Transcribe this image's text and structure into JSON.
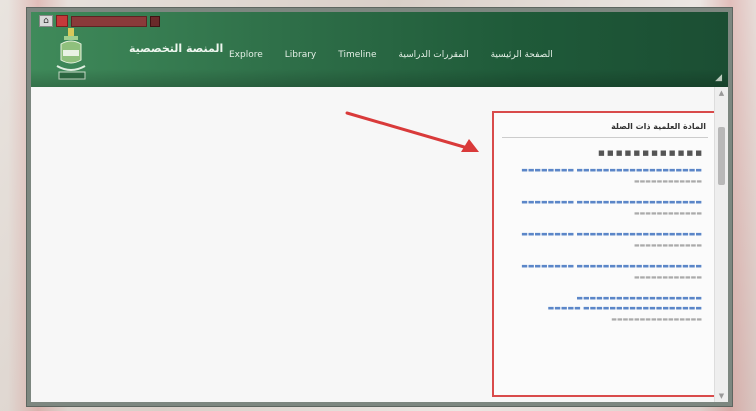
{
  "site": {
    "title": "المنصة التخصصية",
    "logo_icon": "university-emblem-icon",
    "topbar_home_icon": "home-icon"
  },
  "nav": {
    "items": [
      {
        "label": "Explore"
      },
      {
        "label": "Library"
      },
      {
        "label": "Timeline"
      },
      {
        "label": "المقررات الدراسية"
      },
      {
        "label": "الصفحة الرئيسية"
      }
    ]
  },
  "panel": {
    "title": "المادة العلمية ذات الصلة",
    "subtitle": "■ ■ ■ ■ ■ ■ ■ ■ ■ ■ ■ ■",
    "results": [
      {
        "link": "▬▬▬▬▬▬▬▬▬▬▬▬▬▬▬▬▬▬▬ ▬▬▬▬▬▬▬▬",
        "meta": "▬▬▬▬▬▬▬▬▬▬▬▬"
      },
      {
        "link": "▬▬▬▬▬▬▬▬▬▬▬▬▬▬▬▬▬▬▬ ▬▬▬▬▬▬▬▬",
        "meta": "▬▬▬▬▬▬▬▬▬▬▬▬"
      },
      {
        "link": "▬▬▬▬▬▬▬▬▬▬▬▬▬▬▬▬▬▬▬ ▬▬▬▬▬▬▬▬",
        "meta": "▬▬▬▬▬▬▬▬▬▬▬▬"
      },
      {
        "link": "▬▬▬▬▬▬▬▬▬▬▬▬▬▬▬▬▬▬▬ ▬▬▬▬▬▬▬▬",
        "meta": "▬▬▬▬▬▬▬▬▬▬▬▬"
      },
      {
        "link": "▬▬▬▬▬▬▬▬▬▬▬▬▬▬▬▬▬▬▬ ▬▬▬▬▬▬▬▬▬▬▬▬▬▬▬▬▬▬ ▬▬▬▬▬",
        "meta": "▬▬▬▬▬▬▬▬▬▬▬▬▬▬▬▬"
      }
    ]
  },
  "colors": {
    "header_green": "#2f7049",
    "highlight_red": "#d94b4b",
    "link_blue": "#5b86c8"
  }
}
